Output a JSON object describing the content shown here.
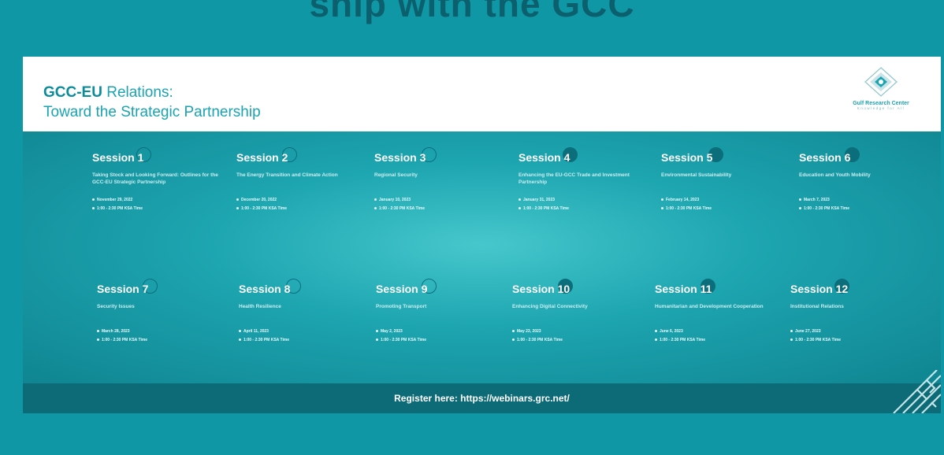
{
  "page": {
    "top_heading": "ship with the GCC",
    "colors": {
      "outer_bg": "#0f97a6",
      "panel_dark": "#0c6b76",
      "title": "#1aa4b2",
      "ring": "#0c6e7b"
    }
  },
  "header": {
    "title_strong": "GCC-EU",
    "title_rest": " Relations:",
    "subtitle": "Toward the Strategic Partnership"
  },
  "logo": {
    "name": "Gulf Research Center",
    "tagline": "Knowledge for All",
    "icon": "grc-diamond-logo-icon"
  },
  "sessions": [
    {
      "label": "Session 1",
      "topic": "Taking Stock and Looking Forward: Outlines for the GCC-EU Strategic Partnership",
      "date": "November 29, 2022",
      "time": "1:00 - 2:30 PM KSA Time"
    },
    {
      "label": "Session 2",
      "topic": "The Energy Transition and Climate Action",
      "date": "December 20, 2022",
      "time": "1:00 - 2:30 PM KSA Time"
    },
    {
      "label": "Session 3",
      "topic": "Regional Security",
      "date": "January 10, 2023",
      "time": "1:00 - 2:30 PM KSA Time"
    },
    {
      "label": "Session 4",
      "topic": "Enhancing the EU-GCC Trade and Investment Partnership",
      "date": "January 31, 2023",
      "time": "1:00 - 2:30 PM KSA Time"
    },
    {
      "label": "Session 5",
      "topic": "Environmental Sustainability",
      "date": "February 14, 2023",
      "time": "1:00 - 2:30 PM KSA Time"
    },
    {
      "label": "Session 6",
      "topic": "Education and Youth Mobility",
      "date": "March 7, 2023",
      "time": "1:00 - 2:30 PM KSA Time"
    },
    {
      "label": "Session 7",
      "topic": "Security Issues",
      "date": "March 28, 2023",
      "time": "1:00 - 2:30 PM KSA Time"
    },
    {
      "label": "Session 8",
      "topic": "Health Resilience",
      "date": "April 11, 2023",
      "time": "1:00 - 2:30 PM KSA Time"
    },
    {
      "label": "Session 9",
      "topic": "Promoting Transport",
      "date": "May 2, 2023",
      "time": "1:00 - 2:30 PM KSA Time"
    },
    {
      "label": "Session 10",
      "topic": "Enhancing Digital Connectivity",
      "date": "May 23, 2023",
      "time": "1:00 - 2:30 PM KSA Time"
    },
    {
      "label": "Session 11",
      "topic": "Humanitarian and Development Cooperation",
      "date": "June 6, 2023",
      "time": "1:00 - 2:30 PM KSA Time"
    },
    {
      "label": "Session 12",
      "topic": "Institutional Relations",
      "date": "June 27, 2023",
      "time": "1:00 - 2:30 PM KSA Time"
    }
  ],
  "footer": {
    "register_text": "Register here: https://webinars.grc.net/"
  }
}
